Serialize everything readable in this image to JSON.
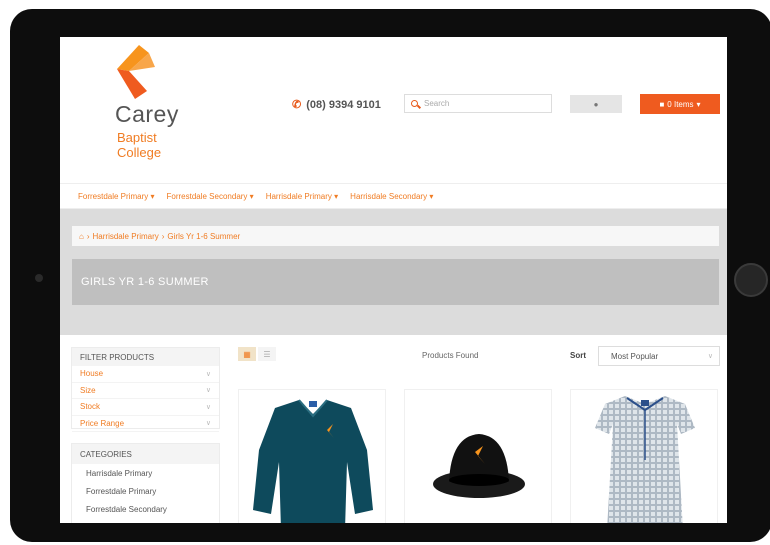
{
  "brand": {
    "name": "Carey",
    "sub1": "Baptist",
    "sub2": "College",
    "accent": "#ef5b1f",
    "orange_text": "#f07c23"
  },
  "header": {
    "phone": "(08) 9394 9101",
    "search_placeholder": "Search",
    "user_icon": "user-icon",
    "cart_label": "0 Items"
  },
  "nav": {
    "items": [
      "Forrestdale Primary",
      "Forrestdale Secondary",
      "Harrisdale Primary",
      "Harrisdale Secondary"
    ]
  },
  "breadcrumb": {
    "current_parent": "Harrisdale Primary",
    "current": "Girls Yr 1-6 Summer"
  },
  "page_title": "GIRLS YR 1-6 SUMMER",
  "filter": {
    "heading": "FILTER PRODUCTS",
    "rows": [
      "House",
      "Size",
      "Stock",
      "Price Range"
    ]
  },
  "categories": {
    "heading": "CATEGORIES",
    "items": [
      "Harrisdale Primary",
      "Forrestdale Primary",
      "Forrestdale Secondary"
    ]
  },
  "toolbar": {
    "products_found": "Products Found",
    "sort_label": "Sort",
    "sort_value": "Most Popular"
  },
  "products": [
    {
      "name": "navy-jumper"
    },
    {
      "name": "black-bucket-hat"
    },
    {
      "name": "check-summer-dress"
    }
  ]
}
